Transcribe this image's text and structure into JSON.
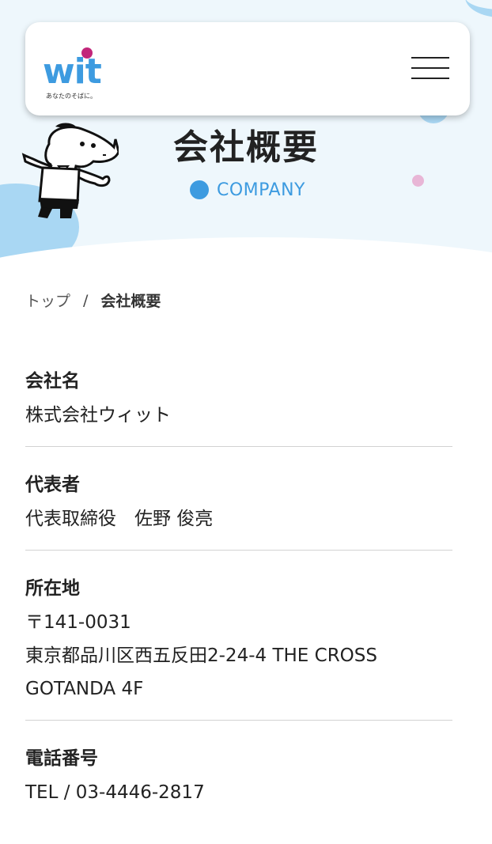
{
  "header": {
    "logo_text": "wit",
    "logo_tagline": "あなたのそばに。"
  },
  "hero": {
    "title": "会社概要",
    "subtitle": "COMPANY"
  },
  "breadcrumb": {
    "home": "トップ",
    "separator": "/",
    "current": "会社概要"
  },
  "company_info": [
    {
      "label": "会社名",
      "value_lines": [
        "株式会社ウィット"
      ]
    },
    {
      "label": "代表者",
      "value_lines": [
        "代表取締役　佐野 俊亮"
      ]
    },
    {
      "label": "所在地",
      "value_lines": [
        "〒141-0031",
        "東京都品川区西五反田2-24-4 THE CROSS",
        "GOTANDA 4F"
      ]
    },
    {
      "label": "電話番号",
      "value_lines": [
        "TEL / 03-4446-2817"
      ]
    }
  ],
  "colors": {
    "accent": "#3d9be0",
    "logo_dot": "#c2267a",
    "hero_bg": "#eef7fc",
    "blob": "#a9d7f3",
    "pink_dot": "#e8b6d6"
  }
}
